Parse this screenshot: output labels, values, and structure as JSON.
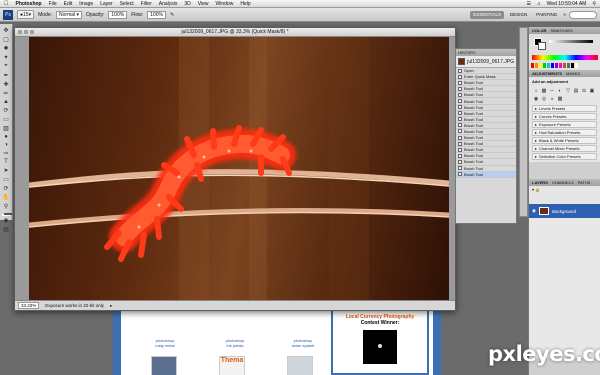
{
  "menubar": {
    "app_name": "Photoshop",
    "menus": [
      "File",
      "Edit",
      "Image",
      "Layer",
      "Select",
      "Filter",
      "Analysis",
      "3D",
      "View",
      "Window",
      "Help"
    ],
    "clock": "Wed 10:59:04 AM",
    "user": "Q"
  },
  "options": {
    "brush_size": "15",
    "mode_label": "Mode:",
    "mode_value": "Normal",
    "opacity_label": "Opacity:",
    "opacity_value": "100%",
    "flow_label": "Flow:",
    "flow_value": "100%",
    "workspaces": [
      "ESSENTIALS",
      "DESIGN",
      "PAINTING"
    ],
    "active_workspace": 0
  },
  "document": {
    "title": "jul132009_0617.JPG @ 33.3% (Quick Mask/8) *",
    "zoom": "33.33%",
    "status": "Exposure works in 32-bit only"
  },
  "history": {
    "tab_label": "HISTORY",
    "snapshot_label": "jul132009_0617.JPG",
    "items": [
      "Open",
      "Enter Quick Mask",
      "Brush Tool",
      "Brush Tool",
      "Brush Tool",
      "Brush Tool",
      "Brush Tool",
      "Brush Tool",
      "Brush Tool",
      "Brush Tool",
      "Brush Tool",
      "Brush Tool",
      "Brush Tool",
      "Brush Tool",
      "Brush Tool",
      "Brush Tool",
      "Brush Tool",
      "Brush Tool"
    ],
    "selected_index": 17
  },
  "dock": {
    "color_tabs": [
      "COLOR",
      "SWATCHES"
    ],
    "adjust_tabs": [
      "ADJUSTMENTS",
      "MASKS"
    ],
    "adjust_title": "Add an adjustment",
    "presets": [
      "Levels Presets",
      "Curves Presets",
      "Exposure Presets",
      "Hue/Saturation Presets",
      "Black & White Presets",
      "Channel Mixer Presets",
      "Selective Color Presets"
    ],
    "layers_tabs": [
      "LAYERS",
      "CHANNELS",
      "PATHS"
    ],
    "layer_name": "Background"
  },
  "webpage": {
    "cols": [
      {
        "name": "sahedi",
        "votes": "10"
      },
      {
        "name": "sahedi",
        "votes": "11"
      },
      {
        "name": "sahedi",
        "votes": "16"
      }
    ],
    "entries": [
      {
        "title": "photoshop",
        "sub": "rusty metal"
      },
      {
        "title": "photoshop",
        "sub": "iris petals"
      },
      {
        "title": "photoshop",
        "sub": "tower splash"
      }
    ],
    "winner_line1": "Local Currency Photography",
    "winner_line2": "Contest Winner:",
    "thumb_text": "Thema"
  },
  "watermark": "pxleyes.com",
  "colors": {
    "mask_red": "#ff2a10",
    "accent_blue": "#2f5fb0",
    "panel_gray": "#cfcfcf"
  }
}
